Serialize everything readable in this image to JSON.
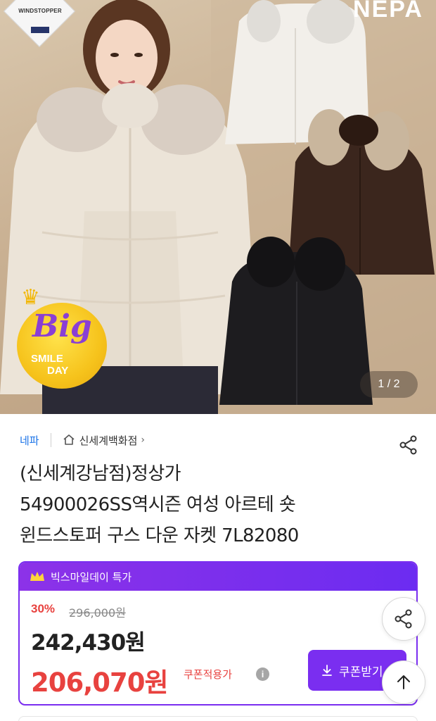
{
  "hero": {
    "brand_logo": "NEPA",
    "badge_text": "WINDSTOPPER",
    "promo_badge": {
      "line1": "Big",
      "line2": "SMILE",
      "line3": "DAY"
    },
    "page_indicator": "1 / 2"
  },
  "product": {
    "brand": "네파",
    "store": "신세계백화점",
    "title_lines": [
      "(신세계강남점)정상가",
      "54900026SS역시즌 여성 아르테 숏",
      "윈드스토퍼 구스 다운 자켓 7L82080"
    ]
  },
  "promo": {
    "label": "빅스마일데이 특가",
    "discount": "30%",
    "original_price": "296,000원",
    "price": "242,430원",
    "coupon_price": "206,070원",
    "coupon_note": "쿠폰적용가",
    "coupon_button": "쿠폰받기"
  },
  "colors": {
    "brand_link": "#1a73e8",
    "promo_purple": "#7a2ef0",
    "sale_red": "#e8423f"
  },
  "icons": [
    "share-icon",
    "home-icon",
    "crown-icon",
    "info-icon",
    "download-icon",
    "arrow-up-icon"
  ]
}
